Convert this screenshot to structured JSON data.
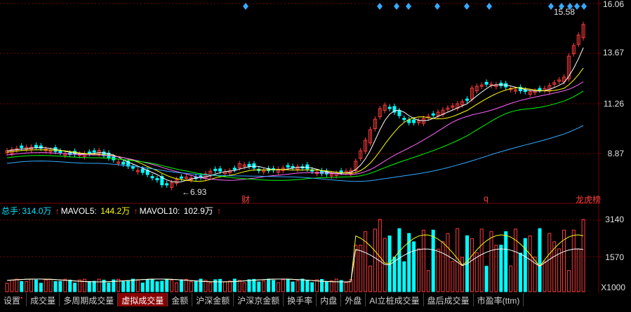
{
  "chart_data": {
    "type": "candlestick",
    "price_axis": {
      "ticks": [
        "16.06",
        "13.67",
        "11.26",
        "8.87"
      ]
    },
    "volume_axis": {
      "ticks": [
        "3140",
        "1570"
      ],
      "unit_label": "X1000"
    },
    "annotations": {
      "low_label": "6.93",
      "high_label": "15.58"
    },
    "markers": [
      "财",
      "q",
      "龙虎榜"
    ],
    "colors": {
      "up": "#ff3b3b",
      "down": "#00ffff",
      "ma5": "#ffffff",
      "ma10": "#ffff00",
      "ma20": "#ff66ff",
      "ma30": "#00ff00",
      "ma60": "#33aaff",
      "grid": "#7a0000"
    }
  },
  "indicators": {
    "total_label": "总手:",
    "total_value": "314.0万",
    "mavol5_label": "MAVOL5:",
    "mavol5_value": "144.2万",
    "mavol10_label": "MAVOL10:",
    "mavol10_value": "102.9万",
    "arrow": "↑"
  },
  "tabs": [
    {
      "label": "设置",
      "sup": "•"
    },
    {
      "label": "成交量"
    },
    {
      "label": "多周期成交量"
    },
    {
      "label": "虚拟成交量",
      "active": true
    },
    {
      "label": "金额"
    },
    {
      "label": "沪深金额"
    },
    {
      "label": "沪深京金额"
    },
    {
      "label": "换手率"
    },
    {
      "label": "内盘"
    },
    {
      "label": "外盘"
    },
    {
      "label": "AI立桩成交量"
    },
    {
      "label": "盘后成交量"
    },
    {
      "label": "市盈率(ttm)"
    }
  ]
}
